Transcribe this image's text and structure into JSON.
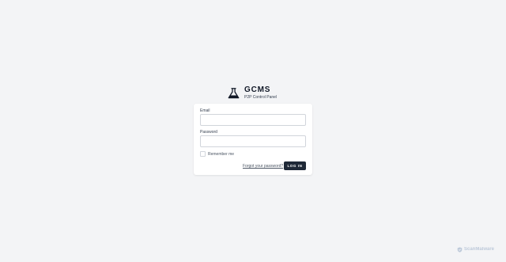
{
  "brand": {
    "title": "GCMS",
    "subtitle": "P2P Control Panel",
    "icon": "flask-icon"
  },
  "form": {
    "email_label": "Email",
    "email_value": "",
    "email_placeholder": "",
    "password_label": "Password",
    "password_value": "",
    "password_placeholder": "",
    "remember_label": "Remember me",
    "remember_checked": false,
    "forgot_link": "Forgot your password?",
    "login_button": "LOG IN"
  },
  "watermark": {
    "text": "ScanMalware",
    "icon": "shield-icon"
  },
  "colors": {
    "background": "#f3f4f6",
    "card": "#ffffff",
    "button": "#1f2937",
    "button_text": "#ffffff"
  }
}
